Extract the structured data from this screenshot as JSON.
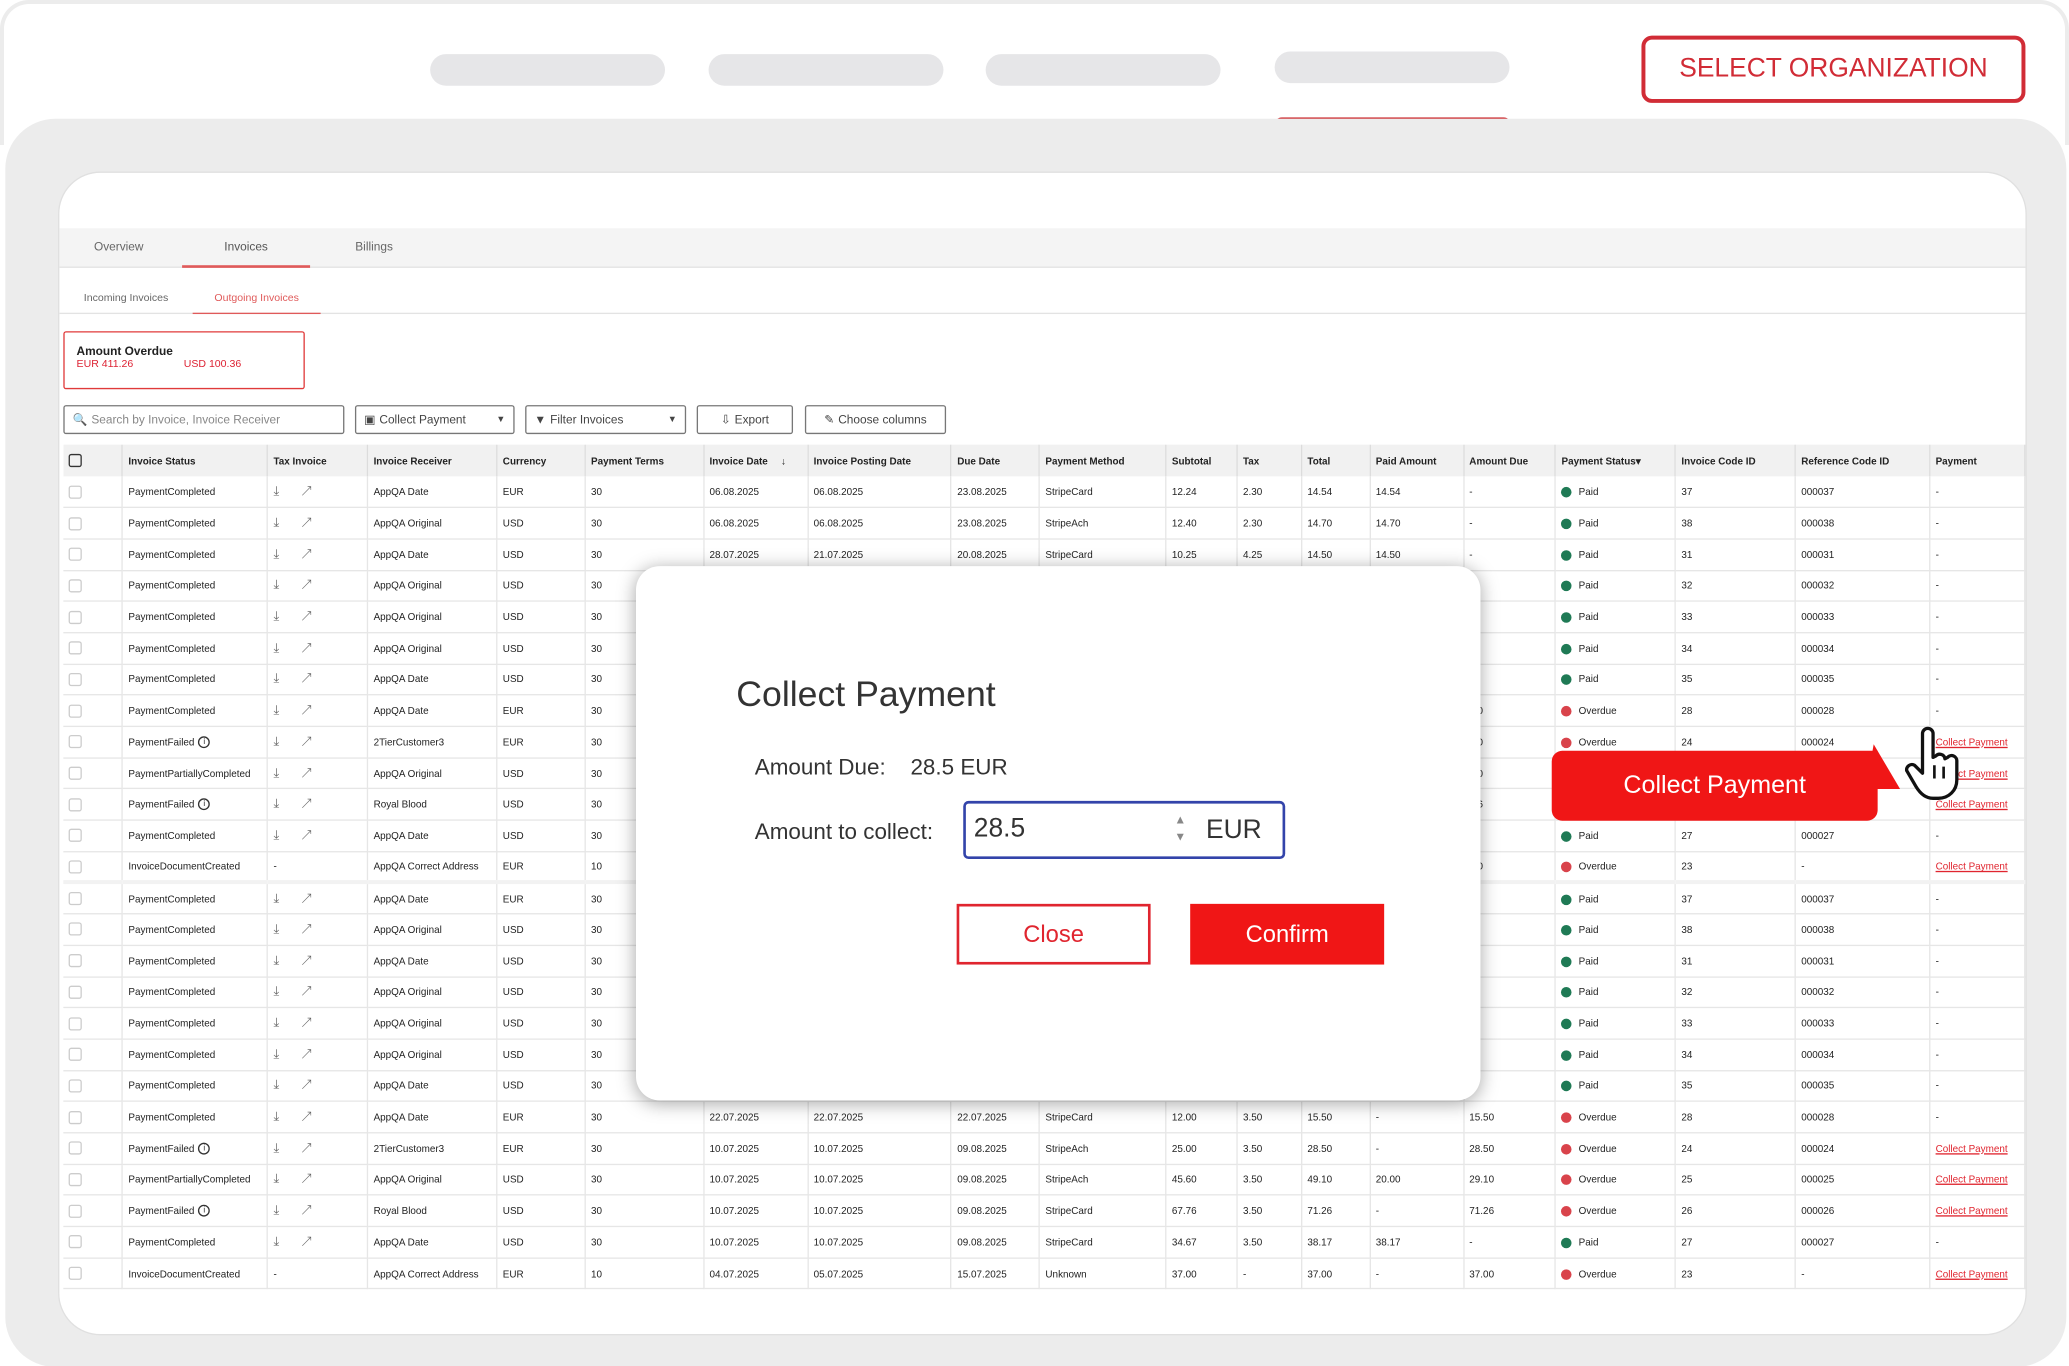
{
  "header": {
    "select_org_label": "SELECT ORGANIZATION"
  },
  "tabs": [
    {
      "label": "Overview"
    },
    {
      "label": "Invoices"
    },
    {
      "label": "Billings"
    }
  ],
  "subtabs": [
    {
      "label": "Incoming Invoices"
    },
    {
      "label": "Outgoing Invoices"
    }
  ],
  "overdue": {
    "title": "Amount Overdue",
    "eur": "EUR 411.26",
    "usd": "USD 100.36"
  },
  "toolbar": {
    "search_placeholder": "Search by Invoice, Invoice Receiver",
    "collect_payment": "Collect Payment",
    "filter_invoices": "Filter Invoices",
    "export": "Export",
    "choose_columns": "Choose columns"
  },
  "table": {
    "headers": [
      "Invoice Status",
      "Tax Invoice",
      "Invoice Receiver",
      "Currency",
      "Payment Terms",
      "Invoice Date",
      "Invoice Posting Date",
      "Due Date",
      "Payment Method",
      "Subtotal",
      "Tax",
      "Total",
      "Paid Amount",
      "Amount Due",
      "Payment Status",
      "Invoice Code ID",
      "Reference Code ID",
      "Payment"
    ],
    "rows": [
      [
        "PaymentCompleted",
        "icons",
        "AppQA Date",
        "EUR",
        "30",
        "06.08.2025",
        "06.08.2025",
        "23.08.2025",
        "StripeCard",
        "12.24",
        "2.30",
        "14.54",
        "14.54",
        "-",
        "Paid",
        "37",
        "000037",
        "-"
      ],
      [
        "PaymentCompleted",
        "icons",
        "AppQA Original",
        "USD",
        "30",
        "06.08.2025",
        "06.08.2025",
        "23.08.2025",
        "StripeAch",
        "12.40",
        "2.30",
        "14.70",
        "14.70",
        "-",
        "Paid",
        "38",
        "000038",
        "-"
      ],
      [
        "PaymentCompleted",
        "icons",
        "AppQA Date",
        "USD",
        "30",
        "28.07.2025",
        "21.07.2025",
        "20.08.2025",
        "StripeCard",
        "10.25",
        "4.25",
        "14.50",
        "14.50",
        "-",
        "Paid",
        "31",
        "000031",
        "-"
      ],
      [
        "PaymentCompleted",
        "icons",
        "AppQA Original",
        "USD",
        "30",
        "",
        "",
        "",
        "",
        "",
        "",
        "",
        "",
        "",
        "Paid",
        "32",
        "000032",
        "-"
      ],
      [
        "PaymentCompleted",
        "icons",
        "AppQA Original",
        "USD",
        "30",
        "",
        "",
        "",
        "",
        "",
        "",
        "",
        "",
        "",
        "Paid",
        "33",
        "000033",
        "-"
      ],
      [
        "PaymentCompleted",
        "icons",
        "AppQA Original",
        "USD",
        "30",
        "",
        "",
        "",
        "",
        "",
        "",
        "",
        "",
        "",
        "Paid",
        "34",
        "000034",
        "-"
      ],
      [
        "PaymentCompleted",
        "icons",
        "AppQA Date",
        "USD",
        "30",
        "",
        "",
        "",
        "",
        "",
        "",
        "",
        "",
        "",
        "Paid",
        "35",
        "000035",
        "-"
      ],
      [
        "PaymentCompleted",
        "icons",
        "AppQA Date",
        "EUR",
        "30",
        "",
        "",
        "",
        "",
        "",
        "",
        "",
        "",
        ".50",
        "Overdue",
        "28",
        "000028",
        "-"
      ],
      [
        "PaymentFailed",
        "icons",
        "2TierCustomer3",
        "EUR",
        "30",
        "",
        "",
        "",
        "",
        "",
        "",
        "",
        "",
        ".50",
        "Overdue",
        "24",
        "000024",
        "Collect Payment"
      ],
      [
        "PaymentPartiallyCompleted",
        "icons",
        "AppQA Original",
        "USD",
        "30",
        "",
        "",
        "",
        "",
        "",
        "",
        "",
        "",
        ".10",
        "",
        "",
        "",
        "Collect Payment"
      ],
      [
        "PaymentFailed",
        "icons",
        "Royal Blood",
        "USD",
        "30",
        "",
        "",
        "",
        "",
        "",
        "",
        "",
        "",
        ".26",
        "",
        "",
        "",
        "Collect Payment"
      ],
      [
        "PaymentCompleted",
        "icons",
        "AppQA Date",
        "USD",
        "30",
        "",
        "",
        "",
        "",
        "",
        "",
        "",
        "",
        "",
        "Paid",
        "27",
        "000027",
        "-"
      ],
      [
        "InvoiceDocumentCreated",
        "-",
        "AppQA Correct Address",
        "EUR",
        "10",
        "",
        "",
        "",
        "",
        "",
        "",
        "",
        "",
        ".00",
        "Overdue",
        "23",
        "-",
        "Collect Payment"
      ],
      [
        "PaymentCompleted",
        "icons",
        "AppQA Date",
        "EUR",
        "30",
        "",
        "",
        "",
        "",
        "",
        "",
        "",
        "",
        "",
        "Paid",
        "37",
        "000037",
        "-"
      ],
      [
        "PaymentCompleted",
        "icons",
        "AppQA Original",
        "USD",
        "30",
        "",
        "",
        "",
        "",
        "",
        "",
        "",
        "",
        "",
        "Paid",
        "38",
        "000038",
        "-"
      ],
      [
        "PaymentCompleted",
        "icons",
        "AppQA Date",
        "USD",
        "30",
        "",
        "",
        "",
        "",
        "",
        "",
        "",
        "",
        "",
        "Paid",
        "31",
        "000031",
        "-"
      ],
      [
        "PaymentCompleted",
        "icons",
        "AppQA Original",
        "USD",
        "30",
        "",
        "",
        "",
        "",
        "",
        "",
        "",
        "",
        "",
        "Paid",
        "32",
        "000032",
        "-"
      ],
      [
        "PaymentCompleted",
        "icons",
        "AppQA Original",
        "USD",
        "30",
        "",
        "",
        "",
        "",
        "",
        "",
        "",
        "",
        "",
        "Paid",
        "33",
        "000033",
        "-"
      ],
      [
        "PaymentCompleted",
        "icons",
        "AppQA Original",
        "USD",
        "30",
        "",
        "",
        "",
        "",
        "",
        "",
        "",
        "",
        "",
        "Paid",
        "34",
        "000034",
        "-"
      ],
      [
        "PaymentCompleted",
        "icons",
        "AppQA Date",
        "USD",
        "30",
        "",
        "",
        "",
        "",
        "",
        "",
        "",
        "",
        "",
        "Paid",
        "35",
        "000035",
        "-"
      ],
      [
        "PaymentCompleted",
        "icons",
        "AppQA Date",
        "EUR",
        "30",
        "22.07.2025",
        "22.07.2025",
        "22.07.2025",
        "StripeCard",
        "12.00",
        "3.50",
        "15.50",
        "-",
        "15.50",
        "Overdue",
        "28",
        "000028",
        "-"
      ],
      [
        "PaymentFailed",
        "icons",
        "2TierCustomer3",
        "EUR",
        "30",
        "10.07.2025",
        "10.07.2025",
        "09.08.2025",
        "StripeAch",
        "25.00",
        "3.50",
        "28.50",
        "-",
        "28.50",
        "Overdue",
        "24",
        "000024",
        "Collect Payment"
      ],
      [
        "PaymentPartiallyCompleted",
        "icons",
        "AppQA Original",
        "USD",
        "30",
        "10.07.2025",
        "10.07.2025",
        "09.08.2025",
        "StripeAch",
        "45.60",
        "3.50",
        "49.10",
        "20.00",
        "29.10",
        "Overdue",
        "25",
        "000025",
        "Collect Payment"
      ],
      [
        "PaymentFailed",
        "icons",
        "Royal Blood",
        "USD",
        "30",
        "10.07.2025",
        "10.07.2025",
        "09.08.2025",
        "StripeCard",
        "67.76",
        "3.50",
        "71.26",
        "-",
        "71.26",
        "Overdue",
        "26",
        "000026",
        "Collect Payment"
      ],
      [
        "PaymentCompleted",
        "icons",
        "AppQA Date",
        "USD",
        "30",
        "10.07.2025",
        "10.07.2025",
        "09.08.2025",
        "StripeCard",
        "34.67",
        "3.50",
        "38.17",
        "38.17",
        "-",
        "Paid",
        "27",
        "000027",
        "-"
      ],
      [
        "InvoiceDocumentCreated",
        "-",
        "AppQA Correct Address",
        "EUR",
        "10",
        "04.07.2025",
        "05.07.2025",
        "15.07.2025",
        "Unknown",
        "37.00",
        "-",
        "37.00",
        "-",
        "37.00",
        "Overdue",
        "23",
        "-",
        "Collect Payment"
      ]
    ]
  },
  "modal": {
    "title": "Collect Payment",
    "amount_due_label": "Amount Due:",
    "amount_due_value": "28.5 EUR",
    "amount_to_collect_label": "Amount to collect:",
    "amount_value": "28.5",
    "currency": "EUR",
    "close_label": "Close",
    "confirm_label": "Confirm"
  },
  "tooltip": {
    "label": "Collect Payment"
  },
  "colors": {
    "accent": "#f01616",
    "paid": "#1f7a55",
    "overdue": "#d9434b"
  }
}
